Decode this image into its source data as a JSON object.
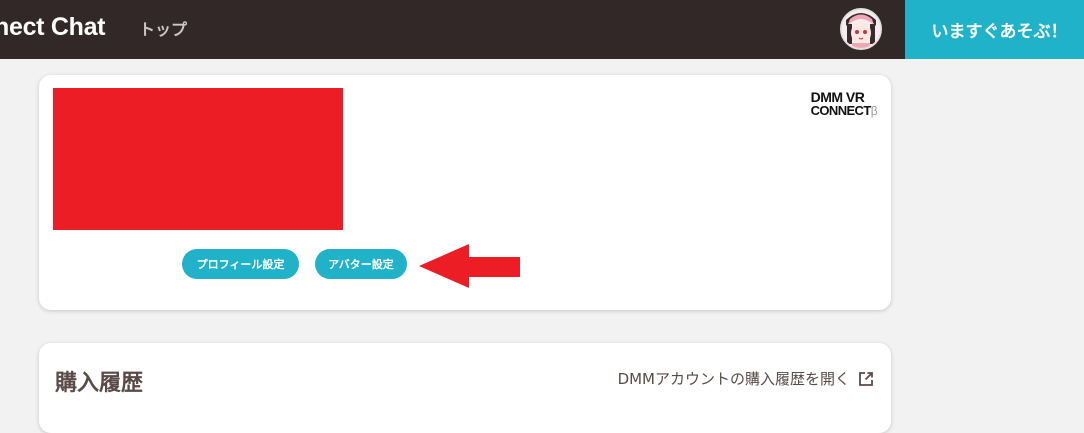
{
  "header": {
    "app_title": "nect Chat",
    "nav_top_label": "トップ",
    "play_button_label": "いますぐあそぶ！",
    "colors": {
      "bar": "#322828",
      "accent": "#1fb2c8"
    }
  },
  "profile_card": {
    "brand_logo_line1": "DMM VR",
    "brand_logo_line2": "CONNECT",
    "brand_logo_beta": "β",
    "profile_settings_label": "プロフィール設定",
    "avatar_settings_label": "アバター設定",
    "annotation_color": "#ec1d24"
  },
  "purchase_card": {
    "title": "購入履歴",
    "dmm_link_label": "DMMアカウントの購入履歴を開く",
    "dmm_link_icon": "external-link-icon"
  }
}
